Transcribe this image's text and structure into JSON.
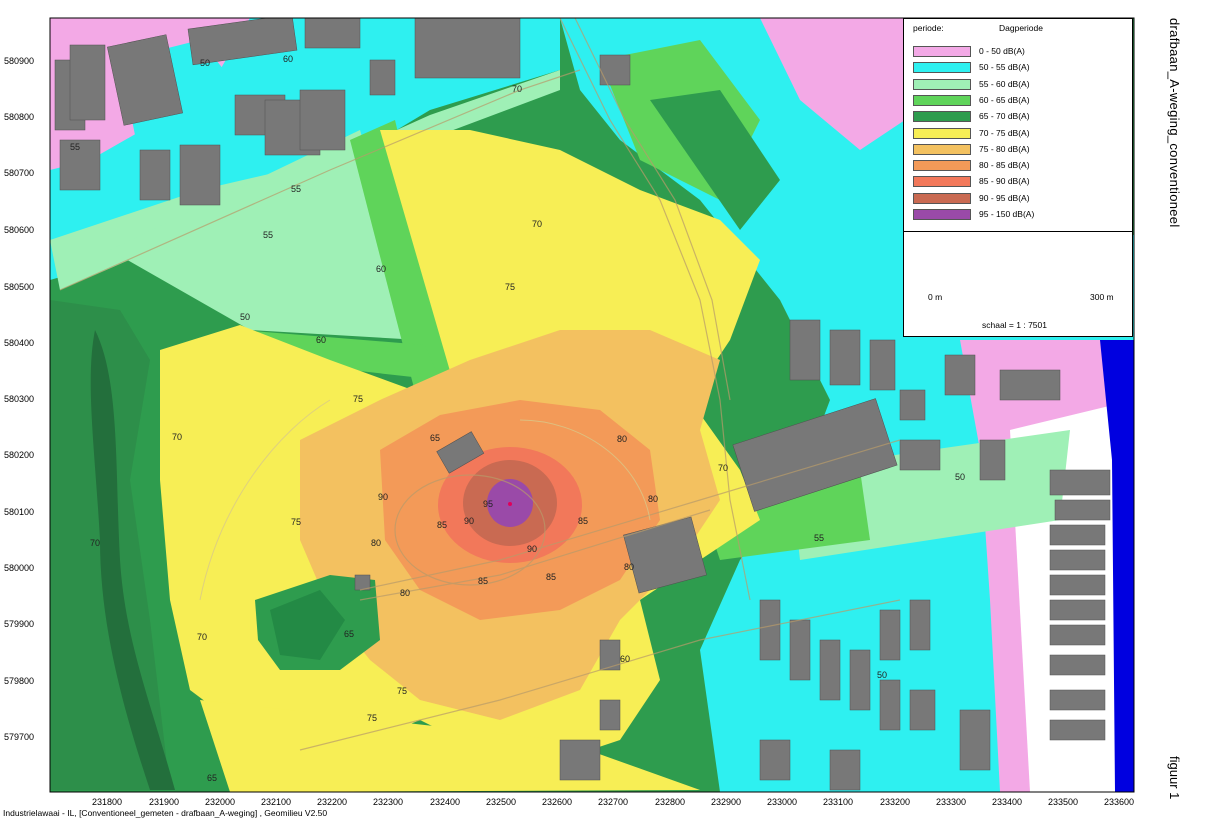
{
  "side_title": "drafbaan_A-weging_conventioneel",
  "figure_label": "figuur 1",
  "footer": "Industrielawaai - IL, [Conventioneel_gemeten - drafbaan_A-weging] , Geomilieu V2.50",
  "legend": {
    "period_label": "periode:",
    "period_value": "Dagperiode",
    "classes": [
      {
        "label": "0 - 50 dB(A)",
        "color": "#f3a9e6"
      },
      {
        "label": "50 - 55 dB(A)",
        "color": "#2ef0f0"
      },
      {
        "label": "55 - 60 dB(A)",
        "color": "#9ff0b6"
      },
      {
        "label": "60 - 65 dB(A)",
        "color": "#5fd45a"
      },
      {
        "label": "65 - 70 dB(A)",
        "color": "#2e9c4e"
      },
      {
        "label": "70 - 75 dB(A)",
        "color": "#f7ee55"
      },
      {
        "label": "75 - 80 dB(A)",
        "color": "#f3c160"
      },
      {
        "label": "80 - 85 dB(A)",
        "color": "#f39a58"
      },
      {
        "label": "85 - 90 dB(A)",
        "color": "#f2785a"
      },
      {
        "label": "90 - 95 dB(A)",
        "color": "#c96a52"
      },
      {
        "label": "95 - 150 dB(A)",
        "color": "#9a4aa8"
      }
    ]
  },
  "scale": {
    "start": "0 m",
    "end": "300 m",
    "ratio": "schaal = 1 : 7501"
  },
  "y_labels": [
    "580900",
    "580800",
    "580700",
    "580600",
    "580500",
    "580400",
    "580300",
    "580200",
    "580100",
    "580000",
    "579900",
    "579800",
    "579700"
  ],
  "x_labels": [
    "231800",
    "231900",
    "232000",
    "232100",
    "232200",
    "232300",
    "232400",
    "232500",
    "232600",
    "232700",
    "232800",
    "232900",
    "233000",
    "233100",
    "233200",
    "233300",
    "233400",
    "233500",
    "233600"
  ],
  "contour_labels": [
    "50",
    "55",
    "60",
    "65",
    "70",
    "75",
    "80",
    "85",
    "90",
    "95"
  ]
}
